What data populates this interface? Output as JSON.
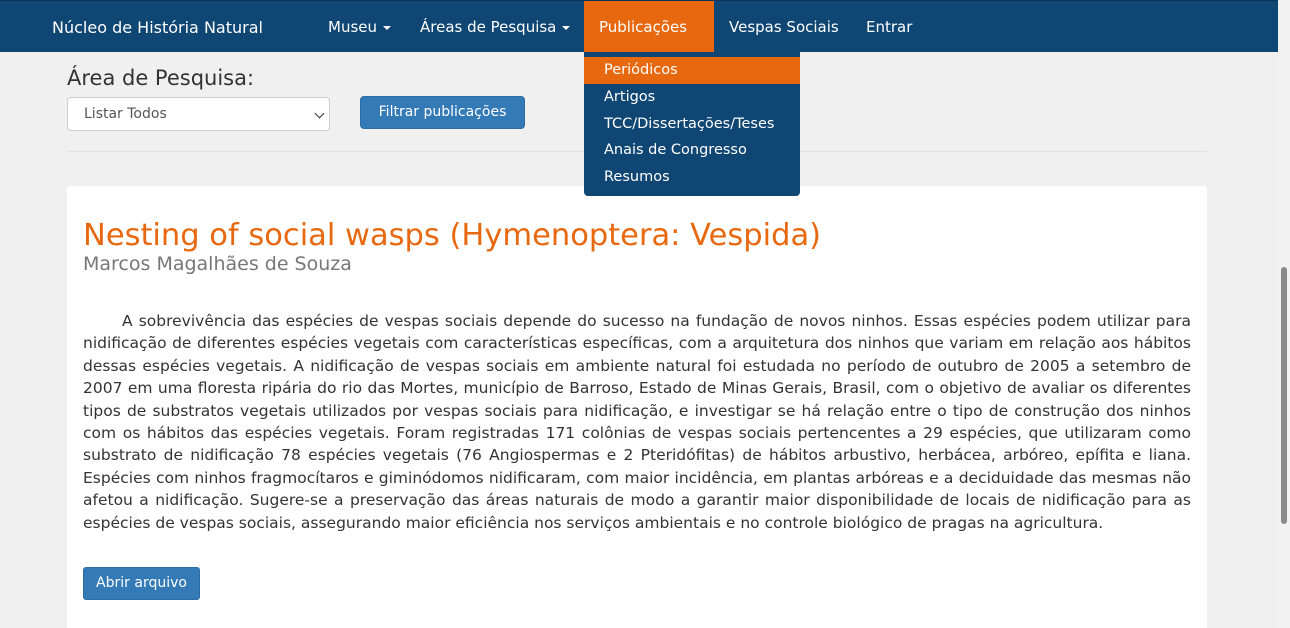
{
  "navbar": {
    "brand": "Núcleo de História Natural",
    "items": [
      {
        "label": "Museu",
        "dropdown": true
      },
      {
        "label": "Áreas de Pesquisa",
        "dropdown": true
      },
      {
        "label": "Publicações",
        "dropdown": true,
        "active": true
      },
      {
        "label": "Vespas Sociais",
        "dropdown": false
      },
      {
        "label": "Entrar",
        "dropdown": false
      }
    ],
    "colors": {
      "background": "#0f4673",
      "active": "#e8680f"
    }
  },
  "publications_menu": {
    "items": [
      {
        "label": "Periódicos",
        "active": true
      },
      {
        "label": "Artigos"
      },
      {
        "label": "TCC/Dissertações/Teses"
      },
      {
        "label": "Anais de Congresso"
      },
      {
        "label": "Resumos"
      }
    ]
  },
  "filter": {
    "label": "Área de Pesquisa:",
    "selected": "Listar Todos",
    "button_label": "Filtrar publicações"
  },
  "publication": {
    "title": "Nesting of social wasps (Hymenoptera: Vespida)",
    "author": "Marcos Magalhães de Souza",
    "abstract": "A sobrevivência das espécies de vespas sociais depende do sucesso na fundação de novos ninhos. Essas espécies podem utilizar para nidificação de diferentes espécies vegetais com características específicas, com a arquitetura dos ninhos que variam em relação aos hábitos dessas espécies vegetais. A nidificação de vespas sociais em ambiente natural foi estudada no período de outubro de 2005 a setembro de 2007 em uma floresta ripária do rio das Mortes, município de Barroso, Estado de Minas Gerais, Brasil, com o objetivo de avaliar os diferentes tipos de substratos vegetais utilizados por vespas sociais para nidificação, e investigar se há relação entre o tipo de construção dos ninhos com os hábitos das espécies vegetais. Foram registradas 171 colônias de vespas sociais pertencentes a 29 espécies, que utilizaram como substrato de nidificação 78 espécies vegetais (76 Angiospermas e 2 Pteridófitas) de hábitos arbustivo, herbácea, arbóreo, epífita e liana. Espécies com ninhos fragmocítaros e giminódomos nidificaram, com maior incidência, em plantas arbóreas e a deciduidade das mesmas não afetou a nidificação. Sugere-se a preservação das áreas naturais de modo a garantir maior disponibilidade de locais de nidificação para as espécies de vespas sociais, assegurando maior eficiência nos serviços ambientais e no controle biológico de pragas na agricultura.",
    "open_button": "Abrir arquivo"
  }
}
